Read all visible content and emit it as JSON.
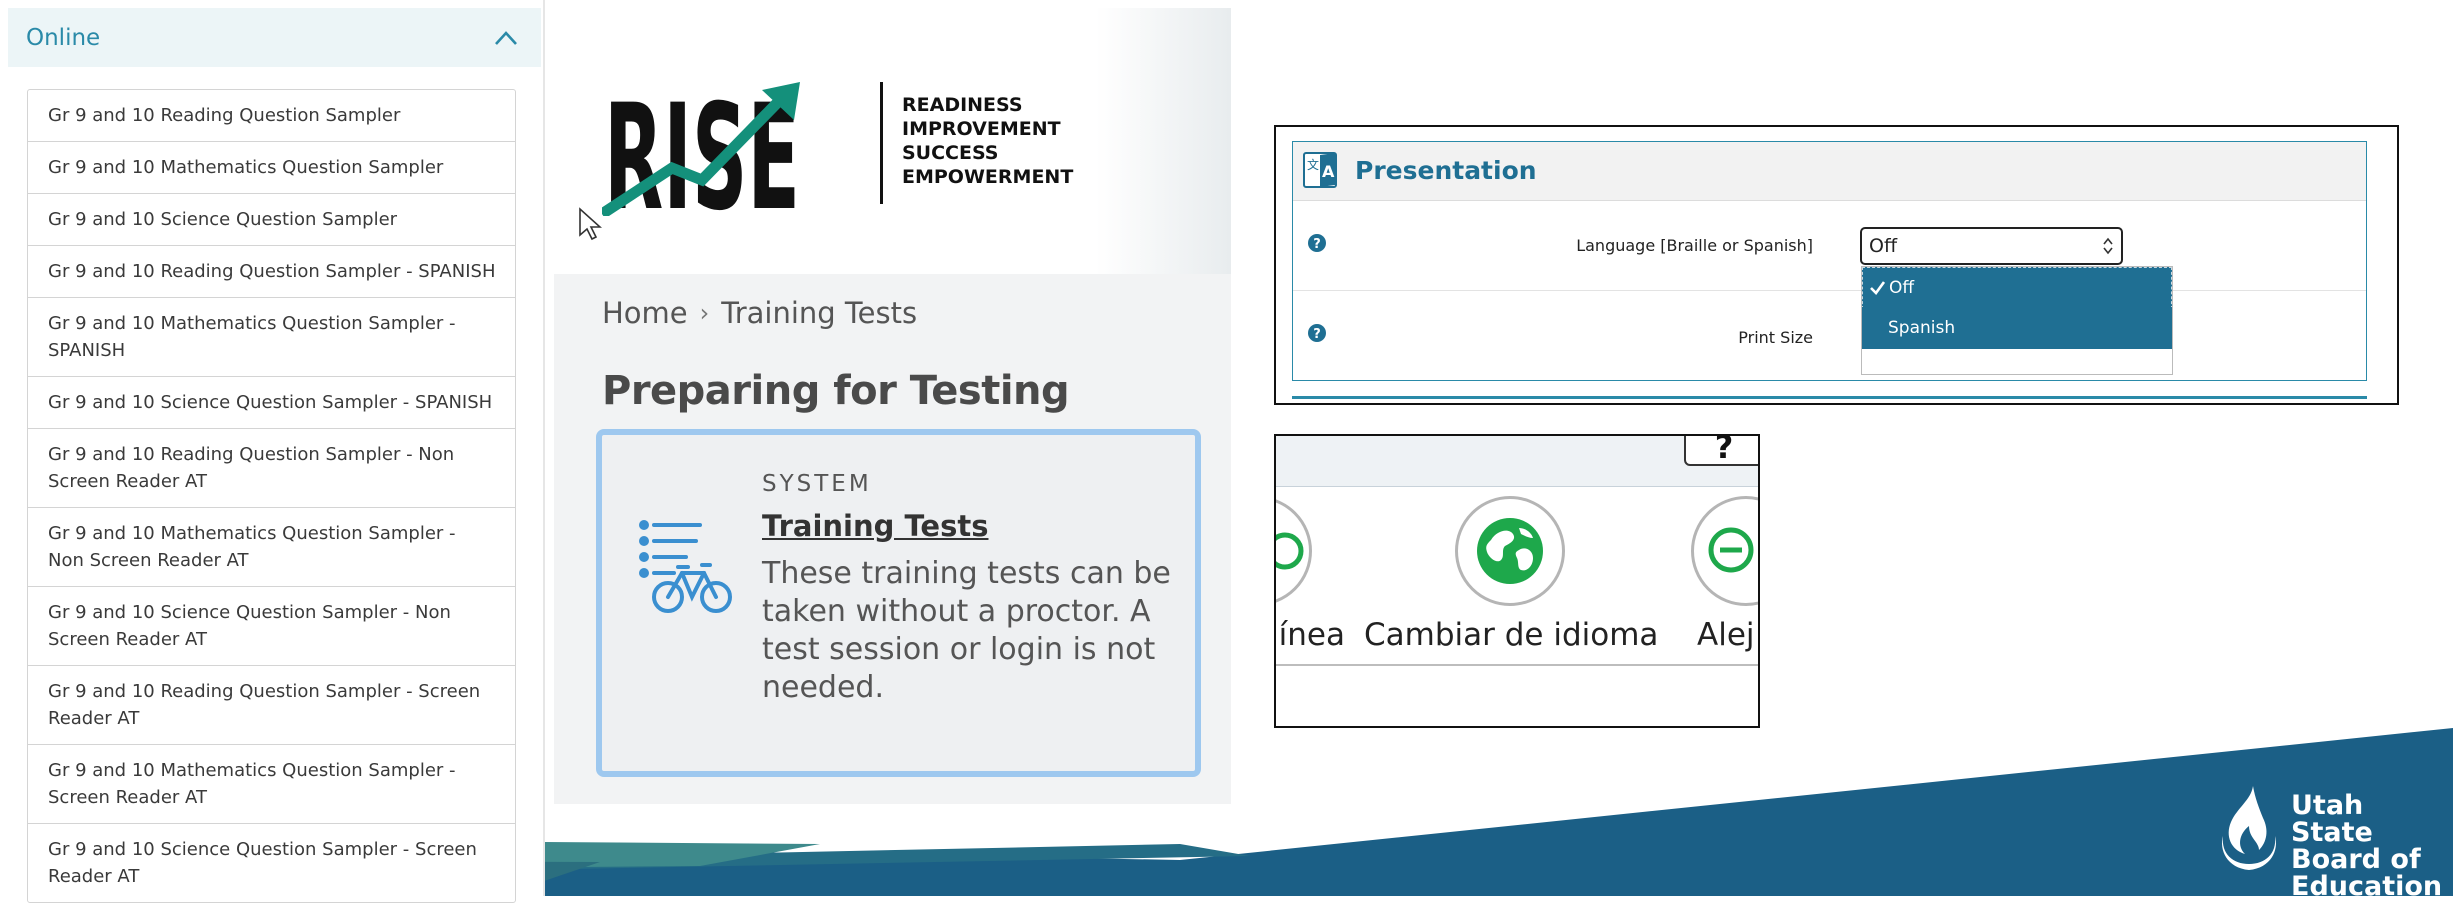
{
  "accordion": {
    "title": "Online",
    "items": [
      "Gr 9 and 10 Reading Question Sampler",
      "Gr 9 and 10 Mathematics Question Sampler",
      "Gr 9 and 10 Science Question Sampler",
      "Gr 9 and 10 Reading Question Sampler - SPANISH",
      "Gr 9 and 10 Mathematics Question Sampler - SPANISH",
      "Gr 9 and 10 Science Question Sampler - SPANISH",
      "Gr 9 and 10 Reading Question Sampler - Non Screen Reader AT",
      "Gr 9 and 10 Mathematics Question Sampler - Non Screen Reader AT",
      "Gr 9 and 10 Science Question Sampler - Non Screen Reader AT",
      "Gr 9 and 10 Reading Question Sampler - Screen Reader AT",
      "Gr 9 and 10 Mathematics Question Sampler - Screen Reader AT",
      "Gr 9 and 10 Science Question Sampler - Screen Reader AT"
    ]
  },
  "rise": {
    "logo_text": "RISE",
    "tagline": [
      "READINESS",
      "IMPROVEMENT",
      "SUCCESS",
      "EMPOWERMENT"
    ],
    "breadcrumb": {
      "home": "Home",
      "separator": "›",
      "current": "Training Tests"
    },
    "page_title": "Preparing for Testing",
    "card": {
      "category": "SYSTEM",
      "title": "Training Tests",
      "description": "These training tests can be taken without a proctor. A test session or login is not needed."
    }
  },
  "presentation": {
    "title": "Presentation",
    "language_label": "Language [Braille or Spanish]",
    "language_value": "Off",
    "options": [
      "Off",
      "Spanish"
    ],
    "print_size_label": "Print Size",
    "help_symbol": "?"
  },
  "tools": {
    "help_symbol": "?",
    "left_label": "línea",
    "globe_label": "Cambiar de idioma",
    "right_label": "Alej"
  },
  "usbe": {
    "lines": [
      "Utah State",
      "Board of",
      "Education"
    ]
  },
  "colors": {
    "accent_teal": "#2a8aa8",
    "presentation_blue": "#1f6f93",
    "banner_dark": "#1b5f86",
    "banner_teal": "#3e8a8c",
    "globe_green": "#1ea84b",
    "rise_arrow": "#14907b"
  },
  "icons": {
    "accordion_toggle": "chevron-up-icon",
    "card": "training-bicycle-list-icon",
    "presentation": "language-book-icon",
    "help": "question-circle-icon",
    "check": "check-icon",
    "globe": "globe-icon",
    "usbe": "flame-icon"
  }
}
